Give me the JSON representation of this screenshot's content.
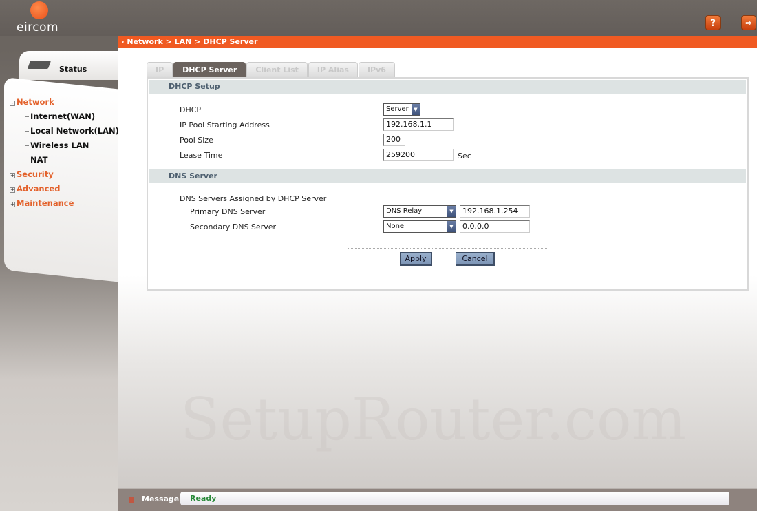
{
  "header": {
    "brand": "eircom",
    "help_icon": "question-icon",
    "logout_icon": "logout-icon",
    "brand_color": "#f05a22"
  },
  "breadcrumb": "Network > LAN > DHCP Server",
  "sidebar": {
    "status_label": "Status",
    "items": [
      {
        "label": "Network",
        "expanded": true
      },
      {
        "label": "Internet(WAN)"
      },
      {
        "label": "Local Network(LAN)"
      },
      {
        "label": "Wireless LAN"
      },
      {
        "label": "NAT"
      },
      {
        "label": "Security",
        "expanded": false
      },
      {
        "label": "Advanced",
        "expanded": false
      },
      {
        "label": "Maintenance",
        "expanded": false
      }
    ]
  },
  "tabs": [
    {
      "label": "IP"
    },
    {
      "label": "DHCP Server",
      "active": true
    },
    {
      "label": "Client List"
    },
    {
      "label": "IP Alias"
    },
    {
      "label": "IPv6"
    }
  ],
  "dhcp_setup": {
    "title": "DHCP Setup",
    "dhcp_label": "DHCP",
    "dhcp_value": "Server",
    "pool_start_label": "IP Pool Starting Address",
    "pool_start_value": "192.168.1.1",
    "pool_size_label": "Pool Size",
    "pool_size_value": "200",
    "lease_label": "Lease Time",
    "lease_value": "259200",
    "lease_unit": "Sec"
  },
  "dns": {
    "title": "DNS Server",
    "assigned_label": "DNS Servers Assigned by DHCP Server",
    "primary_label": "Primary DNS Server",
    "primary_mode": "DNS Relay",
    "primary_value": "192.168.1.254",
    "secondary_label": "Secondary DNS Server",
    "secondary_mode": "None",
    "secondary_value": "0.0.0.0"
  },
  "buttons": {
    "apply": "Apply",
    "cancel": "Cancel"
  },
  "statusbar": {
    "label": "Message",
    "value": "Ready"
  },
  "watermark": "SetupRouter.com"
}
